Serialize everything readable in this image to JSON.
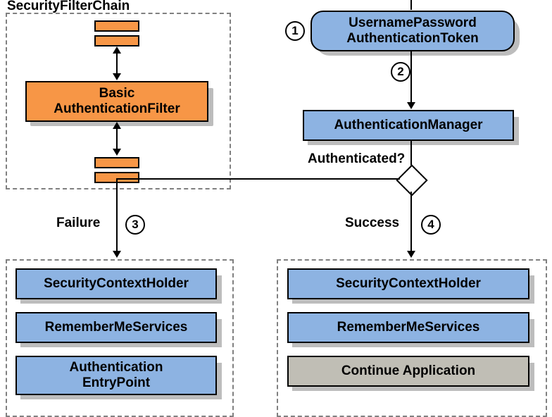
{
  "chain_label": "SecurityFilterChain",
  "filter_label": "Basic\nAuthenticationFilter",
  "token_label": "UsernamePassword\nAuthenticationToken",
  "manager_label": "AuthenticationManager",
  "authq_label": "Authenticated?",
  "failure_label": "Failure",
  "success_label": "Success",
  "fail_items": [
    "SecurityContextHolder",
    "RememberMeServices",
    "Authentication\nEntryPoint"
  ],
  "success_items": [
    "SecurityContextHolder",
    "RememberMeServices",
    "Continue Application"
  ],
  "nums": {
    "n1": "1",
    "n2": "2",
    "n3": "3",
    "n4": "4"
  }
}
